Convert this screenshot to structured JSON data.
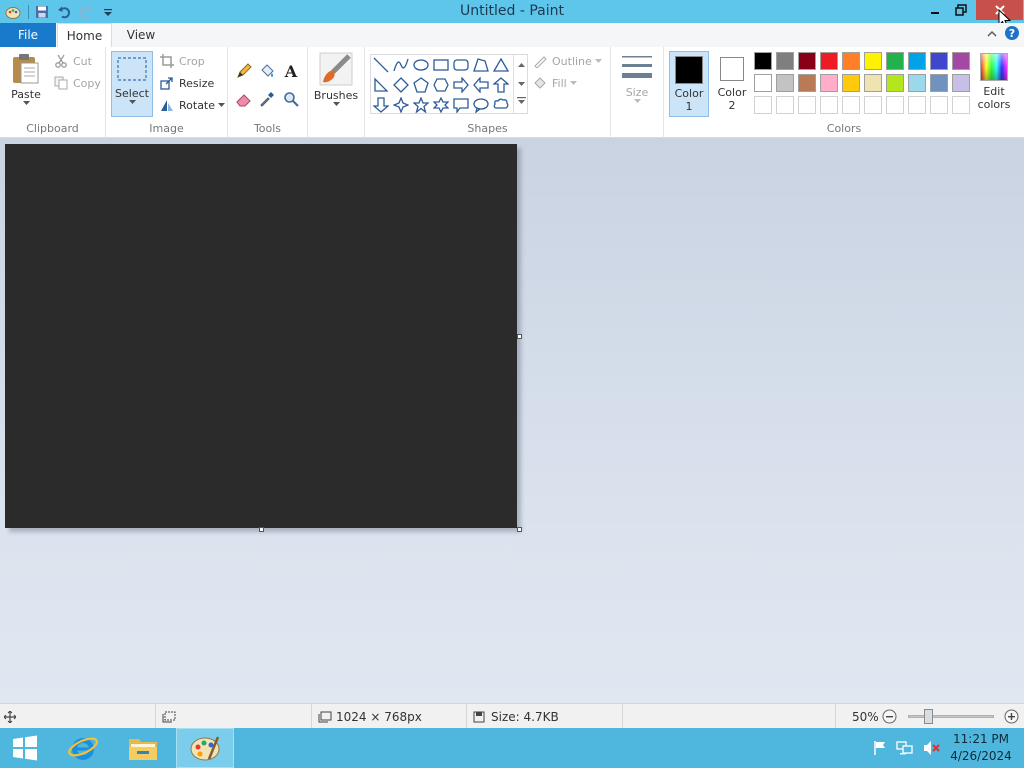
{
  "window": {
    "title": "Untitled - Paint"
  },
  "tabs": {
    "file": "File",
    "home": "Home",
    "view": "View"
  },
  "clipboard": {
    "paste": "Paste",
    "cut": "Cut",
    "copy": "Copy",
    "group": "Clipboard"
  },
  "image": {
    "select": "Select",
    "crop": "Crop",
    "resize": "Resize",
    "rotate": "Rotate",
    "group": "Image"
  },
  "tools": {
    "group": "Tools"
  },
  "brushes": {
    "label": "Brushes"
  },
  "shapes": {
    "outline": "Outline",
    "fill": "Fill",
    "group": "Shapes"
  },
  "size": {
    "label": "Size"
  },
  "colors": {
    "color1_line1": "Color",
    "color1_line2": "1",
    "color2_line1": "Color",
    "color2_line2": "2",
    "edit_line1": "Edit",
    "edit_line2": "colors",
    "group": "Colors",
    "color1": "#000000",
    "color2": "#ffffff",
    "palette_row1": [
      "#000000",
      "#7f7f7f",
      "#880015",
      "#ed1c24",
      "#ff7f27",
      "#fff200",
      "#22b14c",
      "#00a2e8",
      "#3f48cc",
      "#a349a4"
    ],
    "palette_row2": [
      "#ffffff",
      "#c3c3c3",
      "#b97a57",
      "#ffaec9",
      "#ffc90e",
      "#efe4b0",
      "#b5e61d",
      "#99d9ea",
      "#7092be",
      "#c8bfe7"
    ]
  },
  "canvas": {
    "fill": "#2b2b2b"
  },
  "status": {
    "dimensions": "1024 × 768px",
    "size": "Size: 4.7KB",
    "zoom": "50%"
  },
  "taskbar": {
    "time": "11:21 PM",
    "date": "4/26/2024"
  }
}
